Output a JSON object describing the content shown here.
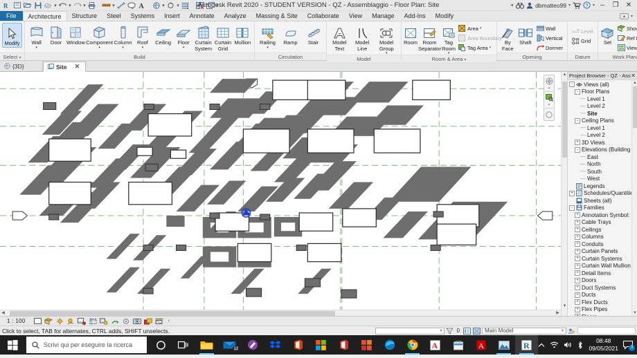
{
  "titlebar": {
    "app_title": "Autodesk Revit 2020 - STUDENT VERSION - QZ - Assemblaggio - Floor Plan: Site",
    "user": "dbmatteo99",
    "qat_icons": [
      "revit-logo-icon",
      "new-icon",
      "open-icon",
      "save-icon",
      "save-as-cloud-icon",
      "undo-icon",
      "redo-icon",
      "print-icon",
      "measure-icon",
      "aligned-dimension-icon",
      "text-note-icon",
      "tag-icon",
      "default-3d-view-icon",
      "section-icon",
      "thin-lines-icon",
      "close-hidden-windows-icon",
      "switch-windows-icon"
    ],
    "search_icon": "binoculars-icon",
    "account_icon": "user-icon",
    "cart_icon": "autodesk-app-store-icon",
    "help_icon": "help-icon",
    "min_label": "–",
    "max_label": "❐",
    "close_label": "✕"
  },
  "tabs": [
    {
      "label": "File",
      "type": "file"
    },
    {
      "label": "Architecture",
      "type": "active"
    },
    {
      "label": "Structure",
      "type": "normal"
    },
    {
      "label": "Steel",
      "type": "normal"
    },
    {
      "label": "Systems",
      "type": "normal"
    },
    {
      "label": "Insert",
      "type": "normal"
    },
    {
      "label": "Annotate",
      "type": "normal"
    },
    {
      "label": "Analyze",
      "type": "normal"
    },
    {
      "label": "Massing & Site",
      "type": "normal"
    },
    {
      "label": "Collaborate",
      "type": "normal"
    },
    {
      "label": "View",
      "type": "normal"
    },
    {
      "label": "Manage",
      "type": "normal"
    },
    {
      "label": "Add-Ins",
      "type": "normal"
    },
    {
      "label": "Modify",
      "type": "normal"
    }
  ],
  "ribbon": {
    "panels": [
      {
        "title": "Select",
        "title_caret": true,
        "buttons": [
          {
            "label": "Modify",
            "icon": "cursor-arrow-icon",
            "selected": true,
            "dropdown": false
          }
        ]
      },
      {
        "title": "Build",
        "title_caret": false,
        "buttons": [
          {
            "label": "Wall",
            "icon": "wall-icon",
            "dropdown": true
          },
          {
            "label": "Door",
            "icon": "door-icon",
            "dropdown": false
          },
          {
            "label": "Window",
            "icon": "window-icon",
            "dropdown": false
          },
          {
            "label": "Component",
            "icon": "component-icon",
            "dropdown": true
          },
          {
            "label": "Column",
            "icon": "column-icon",
            "dropdown": true
          },
          {
            "label": "Roof",
            "icon": "roof-icon",
            "dropdown": true
          },
          {
            "label": "Ceiling",
            "icon": "ceiling-icon",
            "dropdown": false
          },
          {
            "label": "Floor",
            "icon": "floor-icon",
            "dropdown": true
          },
          {
            "label": "Curtain\nSystem",
            "icon": "curtain-system-icon",
            "dropdown": false
          },
          {
            "label": "Curtain\nGrid",
            "icon": "curtain-grid-icon",
            "dropdown": false
          },
          {
            "label": "Mullion",
            "icon": "mullion-icon",
            "dropdown": false
          }
        ]
      },
      {
        "title": "Circulation",
        "title_caret": false,
        "buttons": [
          {
            "label": "Railing",
            "icon": "railing-icon",
            "dropdown": true
          },
          {
            "label": "Ramp",
            "icon": "ramp-icon",
            "dropdown": false
          },
          {
            "label": "Stair",
            "icon": "stair-icon",
            "dropdown": false
          }
        ]
      },
      {
        "title": "Model",
        "title_caret": false,
        "buttons": [
          {
            "label": "Model\nText",
            "icon": "model-text-icon",
            "dropdown": false
          },
          {
            "label": "Model\nLine",
            "icon": "model-line-icon",
            "dropdown": false
          },
          {
            "label": "Model\nGroup",
            "icon": "model-group-icon",
            "dropdown": true
          }
        ]
      },
      {
        "title": "Room & Area",
        "title_caret": true,
        "buttons": [
          {
            "label": "Room",
            "icon": "room-icon",
            "dropdown": false
          },
          {
            "label": "Room\nSeparator",
            "icon": "room-separator-icon",
            "dropdown": false
          },
          {
            "label": "Tag\nRoom",
            "icon": "tag-room-icon",
            "dropdown": true
          }
        ],
        "small_buttons": [
          {
            "label": "Area",
            "icon": "area-icon",
            "dropdown": true,
            "disabled": false
          },
          {
            "label": "Area Boundary",
            "icon": "area-boundary-icon",
            "dropdown": false,
            "disabled": true
          },
          {
            "label": "Tag Area",
            "icon": "tag-area-icon",
            "dropdown": true,
            "disabled": false
          }
        ]
      },
      {
        "title": "Opening",
        "title_caret": false,
        "buttons": [
          {
            "label": "By\nFace",
            "icon": "opening-by-face-icon",
            "dropdown": false
          },
          {
            "label": "Shaft",
            "icon": "shaft-opening-icon",
            "dropdown": false
          }
        ],
        "small_buttons": [
          {
            "label": "Wall",
            "icon": "wall-opening-icon",
            "dropdown": false,
            "disabled": false
          },
          {
            "label": "Vertical",
            "icon": "vertical-opening-icon",
            "dropdown": false,
            "disabled": false
          },
          {
            "label": "Dormer",
            "icon": "dormer-opening-icon",
            "dropdown": false,
            "disabled": false
          }
        ]
      },
      {
        "title": "Datum",
        "title_caret": false,
        "buttons": [],
        "small_buttons": [
          {
            "label": "Level",
            "icon": "level-icon",
            "dropdown": false,
            "disabled": true
          },
          {
            "label": "Grid",
            "icon": "grid-icon",
            "dropdown": false,
            "disabled": false
          }
        ]
      },
      {
        "title": "Work Plane",
        "title_caret": false,
        "buttons": [
          {
            "label": "Set",
            "icon": "set-work-plane-icon",
            "dropdown": false
          }
        ],
        "small_buttons": [
          {
            "label": "Show",
            "icon": "show-work-plane-icon",
            "dropdown": false,
            "disabled": false
          },
          {
            "label": "Ref Plane",
            "icon": "ref-plane-icon",
            "dropdown": false,
            "disabled": false
          },
          {
            "label": "Viewer",
            "icon": "work-plane-viewer-icon",
            "dropdown": false,
            "disabled": false
          }
        ]
      }
    ]
  },
  "view_tabs": [
    {
      "label": "{3D}",
      "active": false,
      "icon": "3d-view-icon",
      "closable": false
    },
    {
      "label": "Site",
      "active": true,
      "icon": "floor-plan-icon",
      "closable": true,
      "close_label": "✕"
    }
  ],
  "browser": {
    "title": "Project Browser - QZ - Ass...",
    "close_label": "✕",
    "tree": [
      {
        "label": "Views (all)",
        "depth": 0,
        "expander": "-",
        "icon": "views-icon",
        "selected": false
      },
      {
        "label": "Floor Plans",
        "depth": 1,
        "expander": "-",
        "icon": "",
        "selected": false
      },
      {
        "label": "Level 1",
        "depth": 2,
        "expander": "dash",
        "icon": "",
        "selected": false
      },
      {
        "label": "Level 2",
        "depth": 2,
        "expander": "dash",
        "icon": "",
        "selected": false
      },
      {
        "label": "Site",
        "depth": 2,
        "expander": "dash",
        "icon": "",
        "selected": true
      },
      {
        "label": "Ceiling Plans",
        "depth": 1,
        "expander": "-",
        "icon": "",
        "selected": false
      },
      {
        "label": "Level 1",
        "depth": 2,
        "expander": "dash",
        "icon": "",
        "selected": false
      },
      {
        "label": "Level 2",
        "depth": 2,
        "expander": "dash",
        "icon": "",
        "selected": false
      },
      {
        "label": "3D Views",
        "depth": 1,
        "expander": "+",
        "icon": "",
        "selected": false
      },
      {
        "label": "Elevations (Building",
        "depth": 1,
        "expander": "-",
        "icon": "",
        "selected": false
      },
      {
        "label": "East",
        "depth": 2,
        "expander": "dash",
        "icon": "",
        "selected": false
      },
      {
        "label": "North",
        "depth": 2,
        "expander": "dash",
        "icon": "",
        "selected": false
      },
      {
        "label": "South",
        "depth": 2,
        "expander": "dash",
        "icon": "",
        "selected": false
      },
      {
        "label": "West",
        "depth": 2,
        "expander": "dash",
        "icon": "",
        "selected": false
      },
      {
        "label": "Legends",
        "depth": 0,
        "expander": "none",
        "icon": "legend-icon",
        "selected": false
      },
      {
        "label": "Schedules/Quantities",
        "depth": 0,
        "expander": "+",
        "icon": "schedule-icon",
        "selected": false
      },
      {
        "label": "Sheets (all)",
        "depth": 0,
        "expander": "none",
        "icon": "sheet-icon",
        "selected": false
      },
      {
        "label": "Families",
        "depth": 0,
        "expander": "-",
        "icon": "families-icon",
        "selected": false
      },
      {
        "label": "Annotation Symbol:",
        "depth": 1,
        "expander": "+",
        "icon": "",
        "selected": false
      },
      {
        "label": "Cable Trays",
        "depth": 1,
        "expander": "+",
        "icon": "",
        "selected": false
      },
      {
        "label": "Ceilings",
        "depth": 1,
        "expander": "+",
        "icon": "",
        "selected": false
      },
      {
        "label": "Columns",
        "depth": 1,
        "expander": "+",
        "icon": "",
        "selected": false
      },
      {
        "label": "Conduits",
        "depth": 1,
        "expander": "+",
        "icon": "",
        "selected": false
      },
      {
        "label": "Curtain Panels",
        "depth": 1,
        "expander": "+",
        "icon": "",
        "selected": false
      },
      {
        "label": "Curtain Systems",
        "depth": 1,
        "expander": "+",
        "icon": "",
        "selected": false
      },
      {
        "label": "Curtain Wall Mullion",
        "depth": 1,
        "expander": "+",
        "icon": "",
        "selected": false
      },
      {
        "label": "Detail Items",
        "depth": 1,
        "expander": "+",
        "icon": "",
        "selected": false
      },
      {
        "label": "Doors",
        "depth": 1,
        "expander": "+",
        "icon": "",
        "selected": false
      },
      {
        "label": "Duct Systems",
        "depth": 1,
        "expander": "+",
        "icon": "",
        "selected": false
      },
      {
        "label": "Ducts",
        "depth": 1,
        "expander": "+",
        "icon": "",
        "selected": false
      },
      {
        "label": "Flex Ducts",
        "depth": 1,
        "expander": "+",
        "icon": "",
        "selected": false
      },
      {
        "label": "Flex Pipes",
        "depth": 1,
        "expander": "+",
        "icon": "",
        "selected": false
      },
      {
        "label": "Floors",
        "depth": 1,
        "expander": "+",
        "icon": "",
        "selected": false
      }
    ]
  },
  "view_control_bar": {
    "scale": "1 : 100",
    "icons": [
      "detail-level-icon",
      "visual-style-icon",
      "sun-path-icon",
      "shadows-icon",
      "render-dialog-icon",
      "crop-view-icon",
      "show-crop-region-icon",
      "lock-3d-view-icon",
      "temporary-hide-isolate-icon",
      "reveal-hidden-elements-icon",
      "analytical-model-icon",
      "constraints-icon",
      "more-chevron-icon"
    ]
  },
  "statusbar": {
    "message": "Click to select, TAB for alternates, CTRL adds, SHIFT unselects.",
    "filter_count": "0",
    "model_label": "Main Model",
    "icons": [
      "editable-only-icon",
      "filter-icon",
      "exclude-options-icon",
      "worksets-icon",
      "design-options-icon"
    ]
  },
  "canvas": {
    "grid_color": "#7fbf7f",
    "building_fill": "#6e6e6e",
    "selection_color": "#1a3fd0"
  },
  "taskbar": {
    "search_placeholder": "Scrivi qui per eseguire la ricerca",
    "start_icon": "windows-start-icon",
    "search_icon": "search-icon",
    "time": "08:48",
    "date": "09/05/2021",
    "apps": [
      {
        "name": "cortana-icon",
        "label": "O",
        "color": "#ffffff",
        "open": false
      },
      {
        "name": "task-view-icon",
        "label": "□i",
        "color": "#ffffff",
        "open": false
      },
      {
        "name": "file-explorer-icon",
        "label": "",
        "color": "#ffb900",
        "open": true
      },
      {
        "name": "mail-icon",
        "label": "",
        "color": "#0078d4",
        "open": false,
        "badge": "12"
      },
      {
        "name": "paint-3d-icon",
        "label": "",
        "color": "#b146c2",
        "open": false
      },
      {
        "name": "dropbox-icon",
        "label": "",
        "color": "#0061ff",
        "open": false
      },
      {
        "name": "office-icon",
        "label": "",
        "color": "#d83b01",
        "open": false
      },
      {
        "name": "microsoft-store-tiles-icon",
        "label": "",
        "color": "#e64a19",
        "open": false
      },
      {
        "name": "office-word-icon",
        "label": "",
        "color": "#d83b01",
        "open": false
      },
      {
        "name": "windows-tiles-icon",
        "label": "",
        "color": "#e74c3c",
        "open": false
      },
      {
        "name": "edge-icon",
        "label": "",
        "color": "#0078d7",
        "open": false
      },
      {
        "name": "chrome-icon",
        "label": "",
        "color": "#ea4335",
        "open": true
      },
      {
        "name": "autodesk-icon",
        "label": "A",
        "color": "#e02020",
        "open": false
      },
      {
        "name": "microsoft-store-icon",
        "label": "",
        "color": "#ffffff",
        "open": false
      },
      {
        "name": "adobe-acrobat-icon",
        "label": "",
        "color": "#cc0000",
        "open": false
      },
      {
        "name": "photos-icon",
        "label": "",
        "color": "#56a0d3",
        "open": true
      },
      {
        "name": "revit-icon",
        "label": "R",
        "color": "#1c6ea4",
        "open": true,
        "active": true
      }
    ],
    "tray": [
      {
        "name": "show-hidden-icons-icon",
        "label": "⌃"
      },
      {
        "name": "wifi-icon",
        "label": ""
      },
      {
        "name": "volume-icon",
        "label": ""
      },
      {
        "name": "bluetooth-icon",
        "label": ""
      }
    ],
    "notifications_icon": "action-center-icon",
    "notifications_count": "3"
  }
}
